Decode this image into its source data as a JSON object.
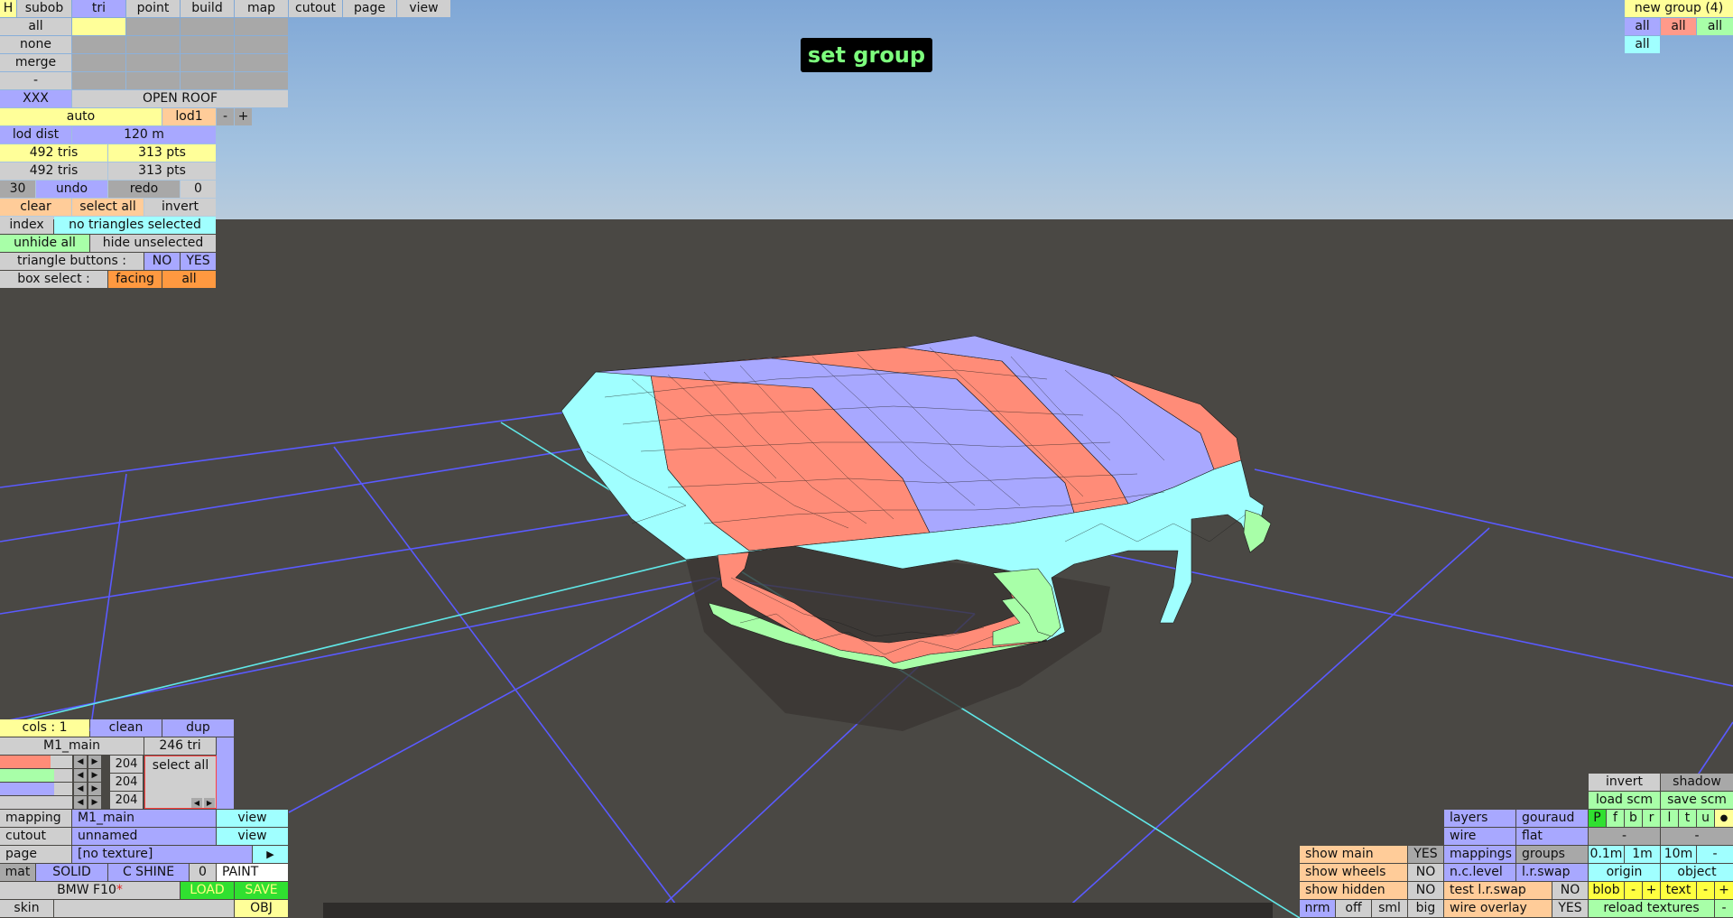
{
  "viewport": {
    "banner": "set group"
  },
  "top_tabs": {
    "h": "H",
    "subob": "subob",
    "tri": "tri",
    "point": "point",
    "build": "build",
    "map": "map",
    "cutout": "cutout",
    "page": "page",
    "view": "view"
  },
  "tri_panel": {
    "all": "all",
    "none": "none",
    "merge": "merge",
    "dash": "-",
    "xxx": "XXX",
    "open_roof": "OPEN ROOF",
    "auto": "auto",
    "lod1": "lod1",
    "minus": "-",
    "plus": "+",
    "lod_dist_label": "lod dist",
    "lod_dist_value": "120 m",
    "tris1": "492 tris",
    "pts1": "313 pts",
    "tris2": "492 tris",
    "pts2": "313 pts",
    "undo_count": "30",
    "undo": "undo",
    "redo": "redo",
    "redo_count": "0",
    "clear": "clear",
    "select_all": "select all",
    "invert": "invert",
    "index": "index",
    "status": "no triangles selected",
    "unhide_all": "unhide all",
    "hide_unselected": "hide unselected",
    "triangle_buttons_label": "triangle buttons :",
    "no": "NO",
    "yes": "YES",
    "box_select_label": "box select :",
    "facing": "facing",
    "box_all": "all"
  },
  "top_right": {
    "new_group": "new group (4)",
    "all1": "all",
    "all2": "all",
    "all3": "all",
    "all4": "all"
  },
  "material_panel": {
    "cols": "cols : 1",
    "clean": "clean",
    "dup": "dup",
    "mesh_name": "M1_main",
    "tri_count": "246 tri",
    "slot_value": "204",
    "select_all": "select all",
    "mapping_label": "mapping",
    "mapping_value": "M1_main",
    "mapping_view": "view",
    "cutout_label": "cutout",
    "cutout_value": "unnamed",
    "cutout_view": "view",
    "page_label": "page",
    "page_value": "[no texture]",
    "page_arrow": "▶",
    "mat": "mat",
    "solid": "SOLID",
    "c_shine": "C SHINE",
    "shine_value": "0",
    "paint": "PAINT",
    "model_name": "BMW F10",
    "asterisk": "*",
    "load": "LOAD",
    "save": "SAVE",
    "skin": "skin",
    "obj": "OBJ"
  },
  "bottom_right": {
    "invert": "invert",
    "shadow": "shadow",
    "load_scm": "load scm",
    "save_scm": "save scm",
    "layers": "layers",
    "gouraud": "gouraud",
    "wire": "wire",
    "flat": "flat",
    "mappings": "mappings",
    "groups": "groups",
    "nc_level": "n.c.level",
    "lr_swap": "l.r.swap",
    "test_lr_swap": "test l.r.swap",
    "test_no": "NO",
    "wire_overlay": "wire overlay",
    "wire_yes": "YES",
    "letters": [
      "P",
      "f",
      "b",
      "r",
      "l",
      "t",
      "u",
      "●"
    ],
    "dash1": "-",
    "dash2": "-",
    "d01": "0.1m",
    "d1": "1m",
    "d10": "10m",
    "dminus": "-",
    "origin": "origin",
    "object": "object",
    "blob": "blob",
    "blob_minus": "-",
    "blob_plus": "+",
    "text": "text",
    "text_minus": "-",
    "text_plus": "+",
    "reload_textures": "reload textures",
    "reload_minus": "-",
    "show_main": "show main",
    "show_main_v": "YES",
    "show_wheels": "show wheels",
    "show_wheels_v": "NO",
    "show_hidden": "show hidden",
    "show_hidden_v": "NO",
    "nrm": "nrm",
    "off": "off",
    "sml": "sml",
    "big": "big"
  }
}
